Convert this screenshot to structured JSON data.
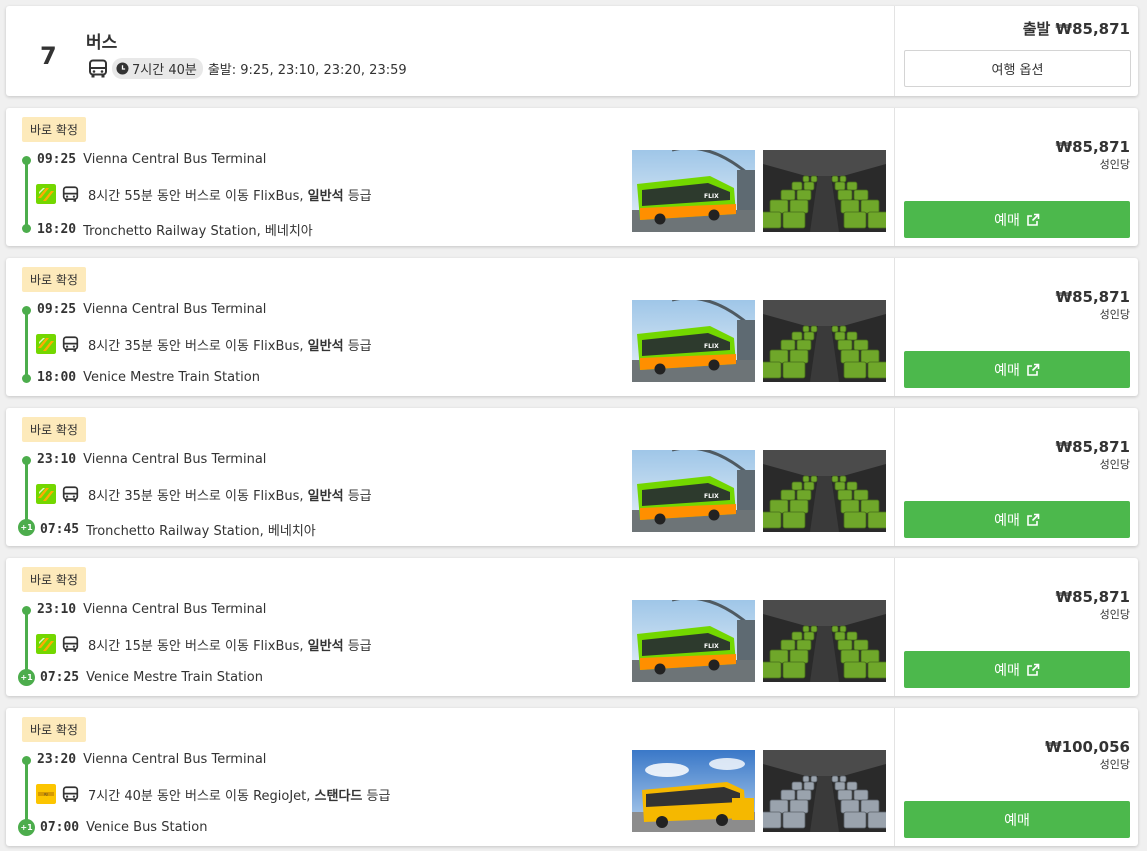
{
  "header": {
    "number": "7",
    "title": "버스",
    "duration": "7시간 40분",
    "departures": "출발: 9:25, 23:10, 23:20, 23:59",
    "price": "출발 ₩85,871",
    "options_label": "여행 옵션"
  },
  "trips": [
    {
      "badge": "바로 확정",
      "dep_time": "09:25",
      "dep_station": "Vienna Central Bus Terminal",
      "mid_prefix": "8시간 55분 동안 버스로 이동 FlixBus, ",
      "mid_class": "일반석",
      "mid_suffix": " 등급",
      "arr_time": "18:20",
      "arr_station": "Tronchetto Railway Station, 베네치아",
      "next_day": "",
      "operator_icon": "flixbus-logo",
      "price": "₩85,871",
      "per": "성인당",
      "book_label": "예매"
    },
    {
      "badge": "바로 확정",
      "dep_time": "09:25",
      "dep_station": "Vienna Central Bus Terminal",
      "mid_prefix": "8시간 35분 동안 버스로 이동 FlixBus, ",
      "mid_class": "일반석",
      "mid_suffix": " 등급",
      "arr_time": "18:00",
      "arr_station": "Venice Mestre Train Station",
      "next_day": "",
      "operator_icon": "flixbus-logo",
      "price": "₩85,871",
      "per": "성인당",
      "book_label": "예매"
    },
    {
      "badge": "바로 확정",
      "dep_time": "23:10",
      "dep_station": "Vienna Central Bus Terminal",
      "mid_prefix": "8시간 35분 동안 버스로 이동 FlixBus, ",
      "mid_class": "일반석",
      "mid_suffix": " 등급",
      "arr_time": "07:45",
      "arr_station": "Tronchetto Railway Station, 베네치아",
      "next_day": "+1",
      "operator_icon": "flixbus-logo",
      "price": "₩85,871",
      "per": "성인당",
      "book_label": "예매"
    },
    {
      "badge": "바로 확정",
      "dep_time": "23:10",
      "dep_station": "Vienna Central Bus Terminal",
      "mid_prefix": "8시간 15분 동안 버스로 이동 FlixBus, ",
      "mid_class": "일반석",
      "mid_suffix": " 등급",
      "arr_time": "07:25",
      "arr_station": "Venice Mestre Train Station",
      "next_day": "+1",
      "operator_icon": "flixbus-logo",
      "price": "₩85,871",
      "per": "성인당",
      "book_label": "예매"
    },
    {
      "badge": "바로 확정",
      "dep_time": "23:20",
      "dep_station": "Vienna Central Bus Terminal",
      "mid_prefix": "7시간 40분 동안 버스로 이동 RegioJet, ",
      "mid_class": "스탠다드",
      "mid_suffix": " 등급",
      "arr_time": "07:00",
      "arr_station": "Venice Bus Station",
      "next_day": "+1",
      "operator_icon": "regiojet-logo",
      "price": "₩100,056",
      "per": "성인당",
      "book_label": "예매"
    }
  ],
  "colors": {
    "accent_green": "#4cb84c",
    "badge_bg": "#fdeabb",
    "flixbus_green": "#73d700",
    "regiojet_yellow": "#fcc500"
  }
}
